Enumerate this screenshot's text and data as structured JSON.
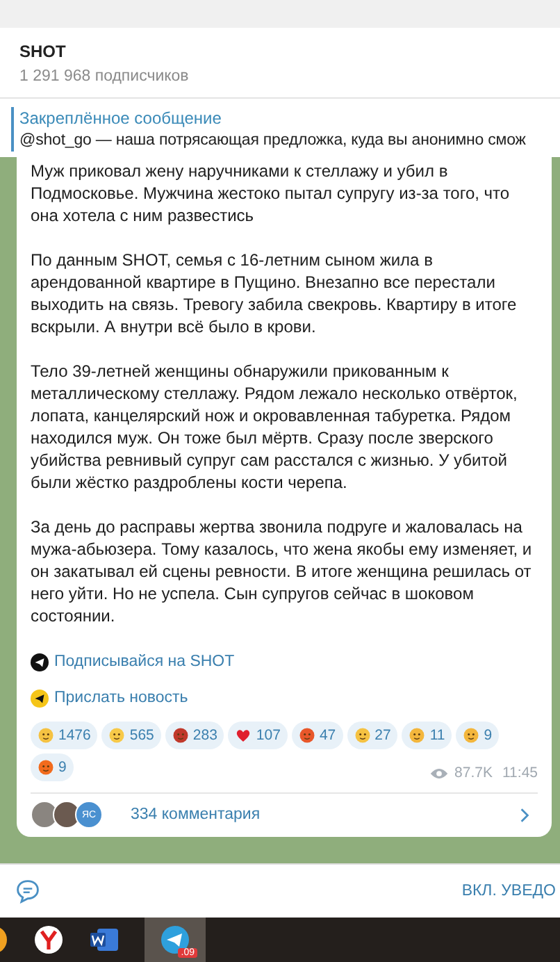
{
  "header": {
    "title": "SHOT",
    "subtitle": "1 291 968 подписчиков"
  },
  "pinned": {
    "label": "Закреплённое сообщение",
    "text": "@shot_go — наша потрясающая предложка, куда вы анонимно смож"
  },
  "message": {
    "paragraphs": [
      "Муж приковал жену наручниками к стеллажу и убил в Подмосковье. Мужчина жестоко пытал супругу из-за того, что она хотела с ним развестись",
      "По данным SHOT, семья с 16-летним сыном жила в арендованной квартире в Пущино. Внезапно все перестали выходить на связь. Тревогу забила свекровь. Квартиру в итоге вскрыли. А внутри всё было в крови.",
      "Тело 39-летней женщины обнаружили прикованным к металлическому стеллажу. Рядом лежало несколько отвёрток, лопата, канцелярский нож и окровавленная табуретка. Рядом находился муж. Он тоже был мёртв. Сразу после зверского убийства ревнивый супруг сам расстался с жизнью. У убитой были жёстко раздроблены кости черепа.",
      "За день до расправы жертва звонила подруге и жаловалась на мужа-абьюзера. Тому казалось, что жена якобы ему изменяет, и он закатывал ей сцены ревности. В итоге женщина решилась от него уйти. Но не успела. Сын супругов сейчас в шоковом состоянии."
    ],
    "links": [
      {
        "kind": "subscribe",
        "text": "Подписывайся на SHOT"
      },
      {
        "kind": "send",
        "text": "Прислать новость"
      }
    ],
    "reactions": [
      {
        "kind": "cowboy",
        "count": "1476"
      },
      {
        "kind": "scream",
        "count": "565"
      },
      {
        "kind": "swearing",
        "count": "283"
      },
      {
        "kind": "heart",
        "count": "107"
      },
      {
        "kind": "angry",
        "count": "47"
      },
      {
        "kind": "grin",
        "count": "27"
      },
      {
        "kind": "thumbs-up",
        "count": "11"
      },
      {
        "kind": "thumbs-down",
        "count": "9"
      },
      {
        "kind": "fire",
        "count": "9"
      }
    ],
    "views": "87.7K",
    "time": "11:45",
    "comments": {
      "avatar_initials": "ЯС",
      "label": "334 комментария"
    }
  },
  "bottom_bar": {
    "action": "ВКЛ. УВЕДО"
  },
  "taskbar": {
    "items": [
      {
        "kind": "partial"
      },
      {
        "kind": "browser"
      },
      {
        "kind": "word"
      },
      {
        "kind": "telegram",
        "badge": ".09"
      }
    ]
  }
}
